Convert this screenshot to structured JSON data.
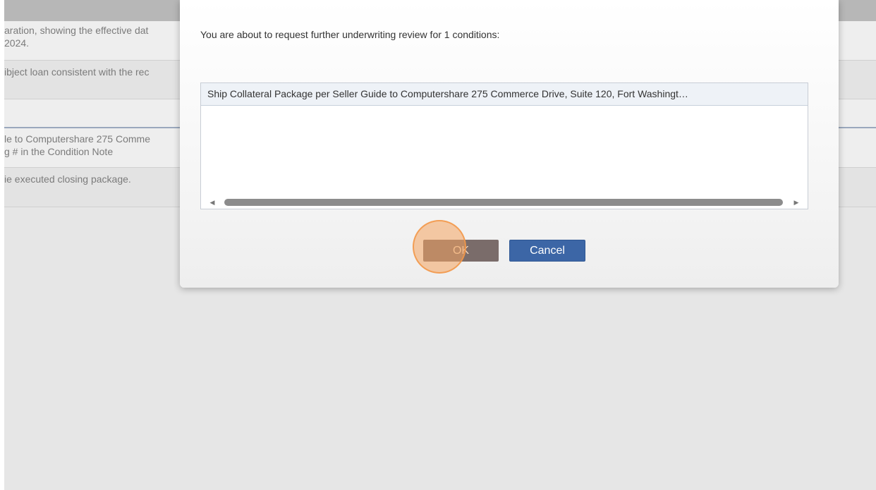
{
  "background": {
    "rows": [
      {
        "lines": [
          "aration, showing the effective dat",
          " 2024."
        ]
      },
      {
        "lines": [
          "ibject loan consistent with the rec"
        ]
      },
      {
        "lines": [
          ""
        ]
      },
      {
        "lines": [
          "le to Computershare 275 Comme",
          "g # in the Condition Note"
        ]
      },
      {
        "lines": [
          "ie executed closing package."
        ]
      }
    ]
  },
  "dialog": {
    "message": "You are about to request further underwriting review for 1 conditions:",
    "items": [
      "Ship Collateral Package per Seller Guide to Computershare 275 Commerce Drive, Suite 120, Fort Washingt…"
    ],
    "ok_label": "OK",
    "cancel_label": "Cancel"
  },
  "colors": {
    "primary_button": "#3c66a6",
    "click_indicator": "#f4a460"
  },
  "icons": {
    "scroll_left": "triangle-left",
    "scroll_right": "triangle-right"
  }
}
